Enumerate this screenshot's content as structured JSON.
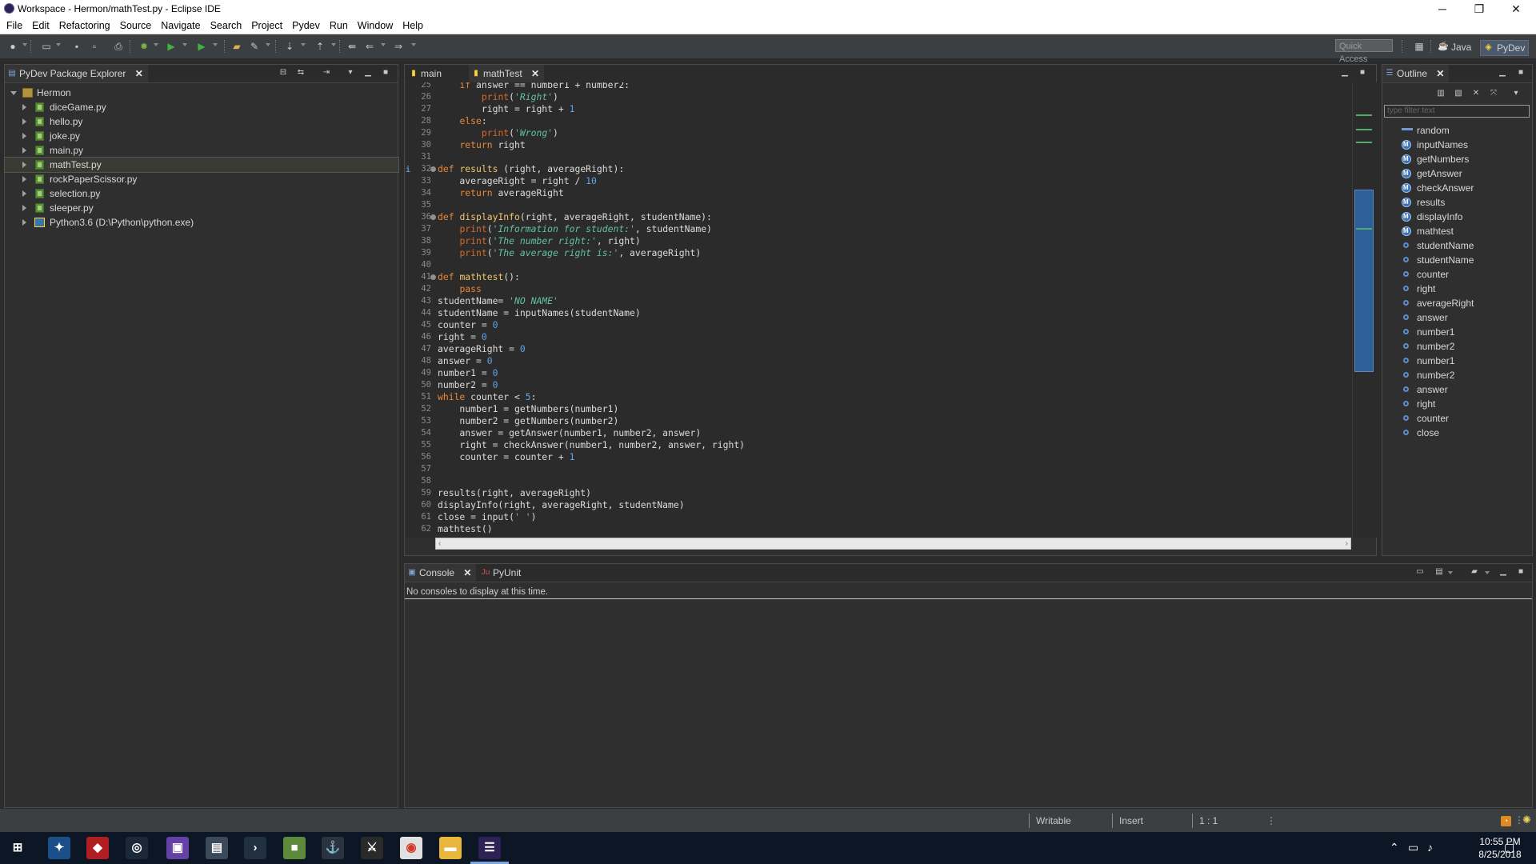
{
  "window": {
    "title": "Workspace - Hermon/mathTest.py - Eclipse IDE",
    "minimize_glyph": "─",
    "maximize_glyph": "❐",
    "close_glyph": "✕"
  },
  "menu": [
    "File",
    "Edit",
    "Refactoring",
    "Source",
    "Navigate",
    "Search",
    "Project",
    "Pydev",
    "Run",
    "Window",
    "Help"
  ],
  "toolbar": {
    "quick_access": "Quick Access",
    "perspectives": [
      {
        "label": "Java",
        "icon": "java-perspective-icon"
      },
      {
        "label": "PyDev",
        "icon": "pydev-perspective-icon"
      }
    ]
  },
  "explorer": {
    "tab_label": "PyDev Package Explorer",
    "close_glyph": "✕",
    "project": "Hermon",
    "files": [
      "diceGame.py",
      "hello.py",
      "joke.py",
      "main.py",
      "mathTest.py",
      "rockPaperScissor.py",
      "selection.py",
      "sleeper.py"
    ],
    "selected_file": "mathTest.py",
    "interpreter": "Python3.6  (D:\\Python\\python.exe)"
  },
  "editor": {
    "tabs": [
      {
        "label": "main",
        "active": false
      },
      {
        "label": "mathTest",
        "active": true
      }
    ],
    "close_glyph": "✕",
    "lines": [
      {
        "n": 25,
        "tokens": [
          [
            "    ",
            ""
          ],
          [
            "if",
            "kw"
          ],
          [
            " answer == number1 + number2:",
            ""
          ]
        ]
      },
      {
        "n": 26,
        "tokens": [
          [
            "        ",
            ""
          ],
          [
            "print",
            "pk"
          ],
          [
            "(",
            ""
          ],
          [
            "'Right'",
            "st"
          ],
          [
            ")",
            ""
          ]
        ]
      },
      {
        "n": 27,
        "tokens": [
          [
            "        right = right + ",
            ""
          ],
          [
            "1",
            "nm"
          ]
        ]
      },
      {
        "n": 28,
        "tokens": [
          [
            "    ",
            ""
          ],
          [
            "else",
            "kw"
          ],
          [
            ":",
            ""
          ]
        ]
      },
      {
        "n": 29,
        "tokens": [
          [
            "        ",
            ""
          ],
          [
            "print",
            "pk"
          ],
          [
            "(",
            ""
          ],
          [
            "'Wrong'",
            "st"
          ],
          [
            ")",
            ""
          ]
        ]
      },
      {
        "n": 30,
        "tokens": [
          [
            "    ",
            ""
          ],
          [
            "return",
            "kw"
          ],
          [
            " right",
            ""
          ]
        ]
      },
      {
        "n": 31,
        "tokens": []
      },
      {
        "n": 32,
        "fold": true,
        "info": true,
        "tokens": [
          [
            "def",
            "kw"
          ],
          [
            " ",
            ""
          ],
          [
            "results",
            "fn"
          ],
          [
            " (right, averageRight):",
            ""
          ]
        ]
      },
      {
        "n": 33,
        "tokens": [
          [
            "    averageRight = right / ",
            ""
          ],
          [
            "10",
            "nm"
          ]
        ]
      },
      {
        "n": 34,
        "tokens": [
          [
            "    ",
            ""
          ],
          [
            "return",
            "kw"
          ],
          [
            " averageRight",
            ""
          ]
        ]
      },
      {
        "n": 35,
        "tokens": []
      },
      {
        "n": 36,
        "fold": true,
        "tokens": [
          [
            "def",
            "kw"
          ],
          [
            " ",
            ""
          ],
          [
            "displayInfo",
            "fn"
          ],
          [
            "(right, averageRight, studentName):",
            ""
          ]
        ]
      },
      {
        "n": 37,
        "tokens": [
          [
            "    ",
            ""
          ],
          [
            "print",
            "pk"
          ],
          [
            "(",
            ""
          ],
          [
            "'Information for student:'",
            "st"
          ],
          [
            ", studentName)",
            ""
          ]
        ]
      },
      {
        "n": 38,
        "tokens": [
          [
            "    ",
            ""
          ],
          [
            "print",
            "pk"
          ],
          [
            "(",
            ""
          ],
          [
            "'The number right:'",
            "st"
          ],
          [
            ", right)",
            ""
          ]
        ]
      },
      {
        "n": 39,
        "tokens": [
          [
            "    ",
            ""
          ],
          [
            "print",
            "pk"
          ],
          [
            "(",
            ""
          ],
          [
            "'The average right is:'",
            "st"
          ],
          [
            ", averageRight)",
            ""
          ]
        ]
      },
      {
        "n": 40,
        "tokens": []
      },
      {
        "n": 41,
        "fold": true,
        "tokens": [
          [
            "def",
            "kw"
          ],
          [
            " ",
            ""
          ],
          [
            "mathtest",
            "fn"
          ],
          [
            "():",
            ""
          ]
        ]
      },
      {
        "n": 42,
        "tokens": [
          [
            "    ",
            ""
          ],
          [
            "pass",
            "kw"
          ]
        ]
      },
      {
        "n": 43,
        "tokens": [
          [
            "studentName= ",
            ""
          ],
          [
            "'NO NAME'",
            "st"
          ]
        ]
      },
      {
        "n": 44,
        "tokens": [
          [
            "studentName = inputNames(studentName)",
            ""
          ]
        ]
      },
      {
        "n": 45,
        "tokens": [
          [
            "counter = ",
            ""
          ],
          [
            "0",
            "nm"
          ]
        ]
      },
      {
        "n": 46,
        "tokens": [
          [
            "right = ",
            ""
          ],
          [
            "0",
            "nm"
          ]
        ]
      },
      {
        "n": 47,
        "tokens": [
          [
            "averageRight = ",
            ""
          ],
          [
            "0",
            "nm"
          ]
        ]
      },
      {
        "n": 48,
        "tokens": [
          [
            "answer = ",
            ""
          ],
          [
            "0",
            "nm"
          ]
        ]
      },
      {
        "n": 49,
        "tokens": [
          [
            "number1 = ",
            ""
          ],
          [
            "0",
            "nm"
          ]
        ]
      },
      {
        "n": 50,
        "tokens": [
          [
            "number2 = ",
            ""
          ],
          [
            "0",
            "nm"
          ]
        ]
      },
      {
        "n": 51,
        "tokens": [
          [
            "while",
            "kw"
          ],
          [
            " counter < ",
            ""
          ],
          [
            "5",
            "nm"
          ],
          [
            ":",
            ""
          ]
        ]
      },
      {
        "n": 52,
        "tokens": [
          [
            "    number1 = getNumbers(number1)",
            ""
          ]
        ]
      },
      {
        "n": 53,
        "tokens": [
          [
            "    number2 = getNumbers(number2)",
            ""
          ]
        ]
      },
      {
        "n": 54,
        "tokens": [
          [
            "    answer = getAnswer(number1, number2, answer)",
            ""
          ]
        ]
      },
      {
        "n": 55,
        "tokens": [
          [
            "    right = checkAnswer(number1, number2, answer, right)",
            ""
          ]
        ]
      },
      {
        "n": 56,
        "tokens": [
          [
            "    counter = counter + ",
            ""
          ],
          [
            "1",
            "nm"
          ]
        ]
      },
      {
        "n": 57,
        "tokens": []
      },
      {
        "n": 58,
        "tokens": []
      },
      {
        "n": 59,
        "tokens": [
          [
            "results(right, averageRight)",
            ""
          ]
        ]
      },
      {
        "n": 60,
        "tokens": [
          [
            "displayInfo(right, averageRight, studentName)",
            ""
          ]
        ]
      },
      {
        "n": 61,
        "tokens": [
          [
            "close = input(",
            ""
          ],
          [
            "' '",
            "st"
          ],
          [
            ")",
            ""
          ]
        ]
      },
      {
        "n": 62,
        "tokens": [
          [
            "mathtest()",
            ""
          ]
        ]
      }
    ]
  },
  "outline": {
    "tab_label": "Outline",
    "close_glyph": "✕",
    "filter_placeholder": "type filter text",
    "items": [
      {
        "label": "random",
        "kind": "import"
      },
      {
        "label": "inputNames",
        "kind": "function"
      },
      {
        "label": "getNumbers",
        "kind": "function"
      },
      {
        "label": "getAnswer",
        "kind": "function"
      },
      {
        "label": "checkAnswer",
        "kind": "function"
      },
      {
        "label": "results",
        "kind": "function"
      },
      {
        "label": "displayInfo",
        "kind": "function"
      },
      {
        "label": "mathtest",
        "kind": "function"
      },
      {
        "label": "studentName",
        "kind": "variable"
      },
      {
        "label": "studentName",
        "kind": "variable"
      },
      {
        "label": "counter",
        "kind": "variable"
      },
      {
        "label": "right",
        "kind": "variable"
      },
      {
        "label": "averageRight",
        "kind": "variable"
      },
      {
        "label": "answer",
        "kind": "variable"
      },
      {
        "label": "number1",
        "kind": "variable"
      },
      {
        "label": "number2",
        "kind": "variable"
      },
      {
        "label": "number1",
        "kind": "variable"
      },
      {
        "label": "number2",
        "kind": "variable"
      },
      {
        "label": "answer",
        "kind": "variable"
      },
      {
        "label": "right",
        "kind": "variable"
      },
      {
        "label": "counter",
        "kind": "variable"
      },
      {
        "label": "close",
        "kind": "variable"
      }
    ]
  },
  "console": {
    "tabs": [
      {
        "label": "Console",
        "active": true
      },
      {
        "label": "PyUnit",
        "active": false
      }
    ],
    "close_glyph": "✕",
    "message": "No consoles to display at this time."
  },
  "status": {
    "writable": "Writable",
    "insert_mode": "Insert",
    "position": "1 : 1"
  },
  "taskbar": {
    "time": "10:55 PM",
    "date": "8/25/2018",
    "apps": [
      {
        "name": "windows-start-icon",
        "bg": "#0c1624",
        "glyph": "⊞"
      },
      {
        "name": "blizzard-app-icon",
        "bg": "#1b4f8a",
        "glyph": "✦"
      },
      {
        "name": "red-app-icon",
        "bg": "#b01e22",
        "glyph": "◆"
      },
      {
        "name": "steam-app-icon",
        "bg": "#1b2838",
        "glyph": "◎"
      },
      {
        "name": "twitch-app-icon",
        "bg": "#6441a4",
        "glyph": "▣"
      },
      {
        "name": "file-app-icon",
        "bg": "#3a4a5a",
        "glyph": "▤"
      },
      {
        "name": "terminal-app-icon",
        "bg": "#203040",
        "glyph": "›"
      },
      {
        "name": "minecraft-app-icon",
        "bg": "#5d8a3a",
        "glyph": "■"
      },
      {
        "name": "world-of-warships-app-icon",
        "bg": "#2a3340",
        "glyph": "⚓"
      },
      {
        "name": "world-of-tanks-app-icon",
        "bg": "#2a2a2a",
        "glyph": "⚔"
      },
      {
        "name": "chrome-app-icon",
        "bg": "#e0e0e0",
        "glyph": "◉"
      },
      {
        "name": "file-explorer-app-icon",
        "bg": "#e8b63a",
        "glyph": "▬"
      },
      {
        "name": "eclipse-app-icon",
        "bg": "#2c2255",
        "glyph": "☰"
      }
    ]
  },
  "colors": {
    "background": "#2b2b2b",
    "keyword": "#e8883a",
    "function_name": "#f0c76b",
    "string": "#63c29b",
    "number": "#5ea4e8"
  }
}
